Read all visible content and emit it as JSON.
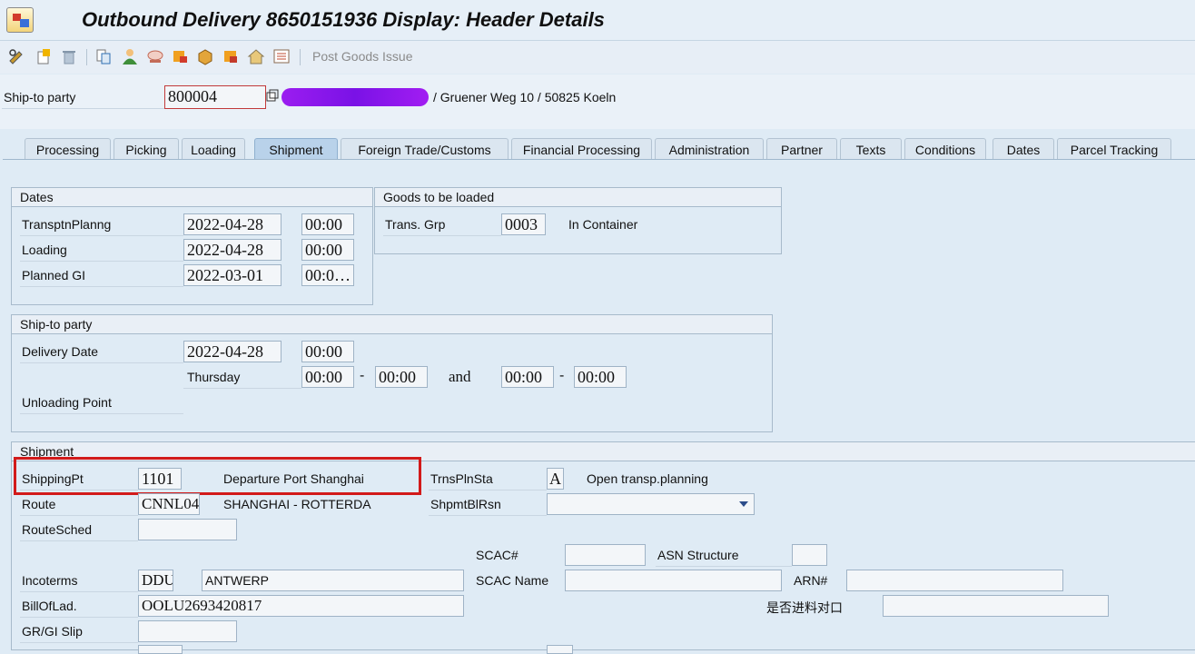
{
  "window": {
    "title": "Outbound Delivery 8650151936 Display: Header Details"
  },
  "toolbar": {
    "icons": [
      "display-change-icon",
      "create-icon",
      "delete-icon",
      "copy-icon",
      "partner-icon",
      "message-icon",
      "box-icon",
      "pack-icon",
      "warehouse-icon",
      "overview-icon"
    ],
    "post_goods_issue": "Post Goods Issue"
  },
  "header": {
    "ship_to_label": "Ship-to party",
    "ship_to_value": "800004",
    "address": "/ Gruener Weg 10 / 50825 Koeln"
  },
  "tabs": [
    {
      "label": "Processing"
    },
    {
      "label": "Picking"
    },
    {
      "label": "Loading"
    },
    {
      "label": "Shipment"
    },
    {
      "label": "Foreign Trade/Customs"
    },
    {
      "label": "Financial Processing"
    },
    {
      "label": "Administration"
    },
    {
      "label": "Partner"
    },
    {
      "label": "Texts"
    },
    {
      "label": "Conditions"
    },
    {
      "label": "Dates"
    },
    {
      "label": "Parcel Tracking"
    }
  ],
  "active_tab": "Shipment",
  "dates": {
    "title": "Dates",
    "rows": [
      {
        "label": "TransptnPlanng",
        "date": "2022-04-28",
        "time": "00:00"
      },
      {
        "label": "Loading",
        "date": "2022-04-28",
        "time": "00:00"
      },
      {
        "label": "Planned GI",
        "date": "2022-03-01",
        "time": "00:0…"
      }
    ]
  },
  "goods": {
    "title": "Goods to be loaded",
    "trans_grp_label": "Trans. Grp",
    "trans_grp_value": "0003",
    "trans_grp_desc": "In Container"
  },
  "shipto": {
    "title": "Ship-to party",
    "delivery_date_label": "Delivery Date",
    "delivery_date": "2022-04-28",
    "delivery_time": "00:00",
    "weekday": "Thursday",
    "from1": "00:00",
    "dash1": "-",
    "to1": "00:00",
    "and": "and",
    "from2": "00:00",
    "dash2": "-",
    "to2": "00:00",
    "unloading_label": "Unloading Point"
  },
  "shipment": {
    "title": "Shipment",
    "shipping_pt_label": "ShippingPt",
    "shipping_pt_value": "1101",
    "shipping_pt_desc": "Departure Port Shanghai",
    "route_label": "Route",
    "route_value": "CNNL04",
    "route_desc": "SHANGHAI  - ROTTERDA",
    "routesched_label": "RouteSched",
    "trnspln_label": "TrnsPlnSta",
    "trnspln_value": "A",
    "trnspln_desc": "Open transp.planning",
    "shpmtblrsn_label": "ShpmtBlRsn",
    "scac_label": "SCAC#",
    "asn_label": "ASN Structure",
    "incoterms_label": "Incoterms",
    "incoterms_value": "DDU",
    "incoterms_loc": "ANTWERP",
    "scac_name_label": "SCAC Name",
    "arn_label": "ARN#",
    "bol_label": "BillOfLad.",
    "bol_value": "OOLU2693420817",
    "chinese_label": "是否进料对口",
    "grgi_label": "GR/GI Slip"
  }
}
